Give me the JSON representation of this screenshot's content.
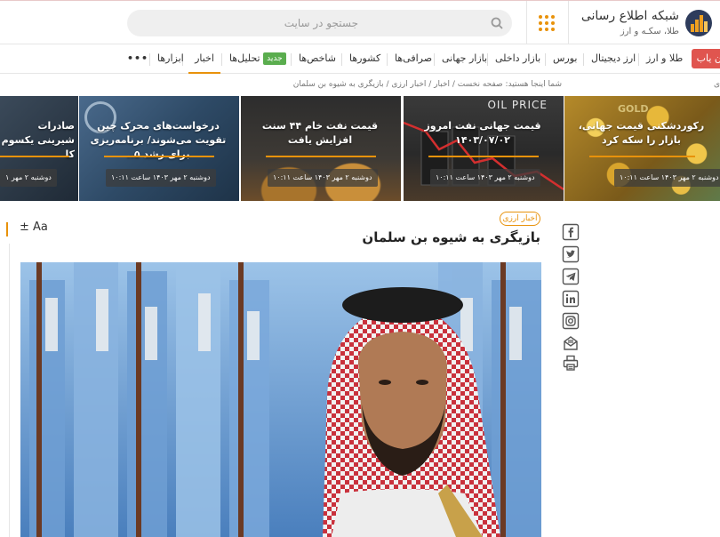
{
  "header": {
    "brand_title": "شبکه اطلاع رسانی",
    "brand_subtitle": "طلا، سکـه و ارز",
    "search_placeholder": "جستجو در سایت"
  },
  "nav": {
    "red_button": "ن یاب",
    "items": [
      "طلا و ارز",
      "ارز دیجیتال",
      "بورس",
      "بازار داخلی",
      "بازار جهانی",
      "صرافی‌ها",
      "کشورها",
      "شاخص‌ها",
      "تحلیل‌ها",
      "اخبار",
      "ابزارها",
      "•••"
    ],
    "new_badge": "جدید",
    "active_item": "اخبار"
  },
  "breadcrumb": {
    "prefix": "شما اینجا هستید:",
    "items": [
      "صفحه نخست",
      "اخبار",
      "اخبار ارزی",
      "بازیگری به شیوه بن سلمان"
    ],
    "edge": "ی"
  },
  "slider": {
    "cards": [
      {
        "title": "رکوردشکنی قیمت جهانی، بازار را سکه کرد",
        "date": "دوشنبه ۲ مهر ۱۴۰۳ ساعت ۱۰:۱۱"
      },
      {
        "title": "قیمت جهانی نفت امروز ۱۴۰۳/۰۷/۰۲",
        "date": "دوشنبه ۲ مهر ۱۴۰۳ ساعت ۱۰:۱۱"
      },
      {
        "title": "قیمت نفت خام ۴۴ سنت افزایش یافت",
        "date": "دوشنبه ۲ مهر ۱۴۰۳ ساعت ۱۰:۱۱"
      },
      {
        "title": "درخواست‌های محرک چین تقویت می‌شوند/ برنامه‌ریزی برای رشد ۵..",
        "date": "دوشنبه ۲ مهر ۱۴۰۳ ساعت ۱۰:۱۱"
      },
      {
        "title": "صادرات شیرینی یکسوم کا",
        "date": "دوشنبه ۲ مهر ۱"
      }
    ],
    "oil_price_label": "OIL PRICE",
    "gold_label": "GOLD"
  },
  "article": {
    "category": "اخبار ارزی",
    "headline": "بازیگری به شیوه بن سلمان",
    "font_tool": "± Aa"
  },
  "share": {
    "icons": [
      "facebook-icon",
      "twitter-icon",
      "telegram-icon",
      "linkedin-icon",
      "instagram-icon",
      "email-icon",
      "print-icon"
    ]
  },
  "colors": {
    "accent": "#e8920b",
    "red_button": "#e0554f",
    "new_badge": "#5aad4e",
    "logo_bg": "#2e3c5c"
  }
}
